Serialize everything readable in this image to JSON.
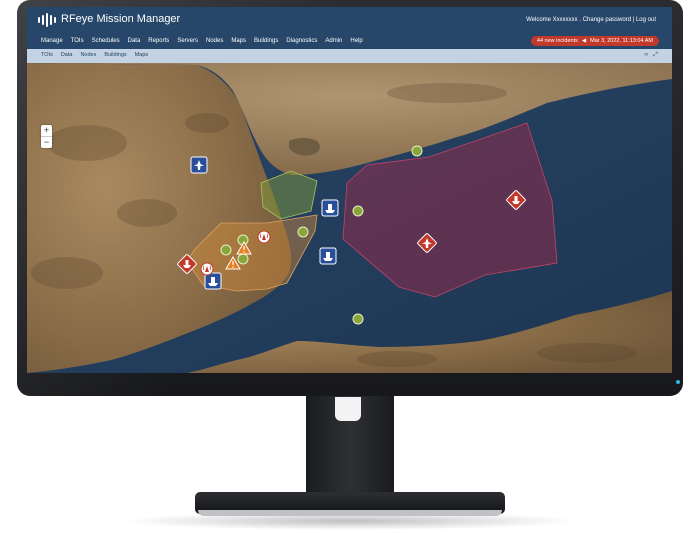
{
  "app": {
    "title": "RFeye Mission Manager",
    "welcome_text": "Welcome Xxxxxxxx .",
    "change_password": "Change password",
    "separator": "|",
    "logout": "Log out"
  },
  "main_nav": [
    "Manage",
    "TOIs",
    "Schedules",
    "Data",
    "Reports",
    "Servers",
    "Nodes",
    "Maps",
    "Buildings",
    "Diagnostics",
    "Admin",
    "Help"
  ],
  "incidents": {
    "label": "44 new incidents",
    "datetime": "Mar 3, 2022, 11:13:04 AM"
  },
  "sub_nav": [
    "TOIs",
    "Data",
    "Nodes",
    "Buildings",
    "Maps"
  ],
  "map": {
    "zoom_in": "+",
    "zoom_out": "−"
  },
  "icons": {
    "logo": "signal-bars-icon",
    "incidents": "bell-icon",
    "sub_tools": [
      "collapse-icon",
      "fullscreen-icon"
    ],
    "markers": [
      "aircraft-icon",
      "ship-icon",
      "radio-tower-icon",
      "warning-icon",
      "node-icon"
    ]
  },
  "colors": {
    "topbar": "#27476a",
    "subnav": "#c3d3e4",
    "incident": "#c0392b",
    "node": "#8aa63a",
    "zone_red": "#9a2a4a",
    "zone_orange": "#d08a3a",
    "zone_green": "#7d9a3a",
    "asset_blue": "#2a4f9a"
  }
}
